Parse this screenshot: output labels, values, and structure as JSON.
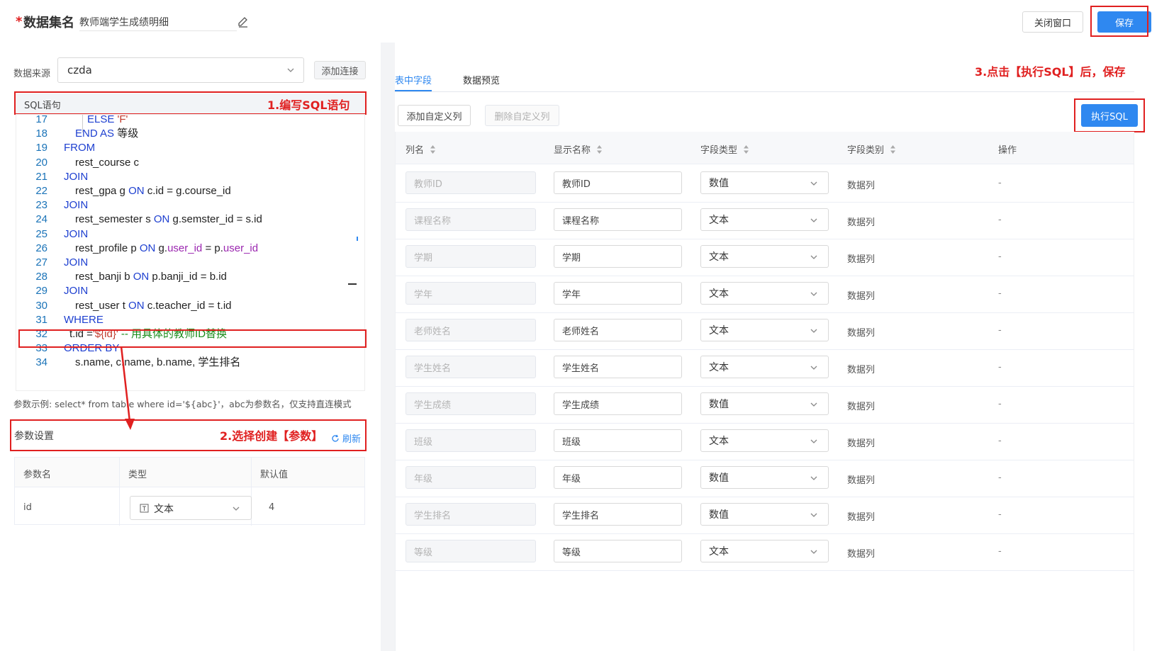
{
  "header": {
    "required_mark": "*",
    "title_label": "数据集名",
    "dataset_name": "教师端学生成绩明细",
    "close_label": "关闭窗口",
    "save_label": "保存"
  },
  "left": {
    "source_label": "数据来源",
    "source_value": "czda",
    "add_connection_label": "添加连接",
    "sql_section_label": "SQL语句",
    "param_hint": "参数示例: select* from table where id='${abc}'，abc为参数名，仅支持直连模式",
    "param_section_title": "参数设置",
    "refresh_label": "刷新",
    "param_table": {
      "headers": [
        "参数名",
        "类型",
        "默认值"
      ],
      "rows": [
        {
          "name": "id",
          "type": "文本",
          "default": "4"
        }
      ]
    }
  },
  "code_lines": [
    {
      "n": "17",
      "t": "ELSE 'F'"
    },
    {
      "n": "18",
      "t": "END AS 等级"
    },
    {
      "n": "19",
      "t": "FROM"
    },
    {
      "n": "20",
      "t": "rest_course c"
    },
    {
      "n": "21",
      "t": "JOIN"
    },
    {
      "n": "22",
      "t": "rest_gpa g ON c.id = g.course_id"
    },
    {
      "n": "23",
      "t": "JOIN"
    },
    {
      "n": "24",
      "t": "rest_semester s ON g.semster_id = s.id"
    },
    {
      "n": "25",
      "t": "JOIN"
    },
    {
      "n": "26",
      "t": "rest_profile p ON g.user_id = p.user_id"
    },
    {
      "n": "27",
      "t": "JOIN"
    },
    {
      "n": "28",
      "t": "rest_banji b ON p.banji_id = b.id"
    },
    {
      "n": "29",
      "t": "JOIN"
    },
    {
      "n": "30",
      "t": "rest_user t ON c.teacher_id = t.id"
    },
    {
      "n": "31",
      "t": "WHERE"
    },
    {
      "n": "32",
      "t": "t.id ='${id}' -- 用具体的教师ID替换"
    },
    {
      "n": "33",
      "t": "ORDER BY"
    },
    {
      "n": "34",
      "t": "s.name, c.name, b.name, 学生排名"
    }
  ],
  "annotations": {
    "step1": "1.编写SQL语句",
    "step2": "2.选择创建【参数】",
    "step3": "3.点击【执行SQL】后，保存"
  },
  "right": {
    "tabs": [
      "表中字段",
      "数据预览"
    ],
    "add_custom_col_label": "添加自定义列",
    "delete_custom_col_label": "删除自定义列",
    "execute_sql_label": "执行SQL",
    "headers": [
      "列名",
      "显示名称",
      "字段类型",
      "字段类别",
      "操作"
    ],
    "rows": [
      {
        "name": "教师ID",
        "display": "教师ID",
        "type": "数值",
        "category": "数据列",
        "op": "-"
      },
      {
        "name": "课程名称",
        "display": "课程名称",
        "type": "文本",
        "category": "数据列",
        "op": "-"
      },
      {
        "name": "学期",
        "display": "学期",
        "type": "文本",
        "category": "数据列",
        "op": "-"
      },
      {
        "name": "学年",
        "display": "学年",
        "type": "文本",
        "category": "数据列",
        "op": "-"
      },
      {
        "name": "老师姓名",
        "display": "老师姓名",
        "type": "文本",
        "category": "数据列",
        "op": "-"
      },
      {
        "name": "学生姓名",
        "display": "学生姓名",
        "type": "文本",
        "category": "数据列",
        "op": "-"
      },
      {
        "name": "学生成绩",
        "display": "学生成绩",
        "type": "数值",
        "category": "数据列",
        "op": "-"
      },
      {
        "name": "班级",
        "display": "班级",
        "type": "文本",
        "category": "数据列",
        "op": "-"
      },
      {
        "name": "年级",
        "display": "年级",
        "type": "数值",
        "category": "数据列",
        "op": "-"
      },
      {
        "name": "学生排名",
        "display": "学生排名",
        "type": "数值",
        "category": "数据列",
        "op": "-"
      },
      {
        "name": "等级",
        "display": "等级",
        "type": "文本",
        "category": "数据列",
        "op": "-"
      }
    ]
  },
  "colors": {
    "accent": "#2f88f0",
    "annotation": "#e02020"
  }
}
